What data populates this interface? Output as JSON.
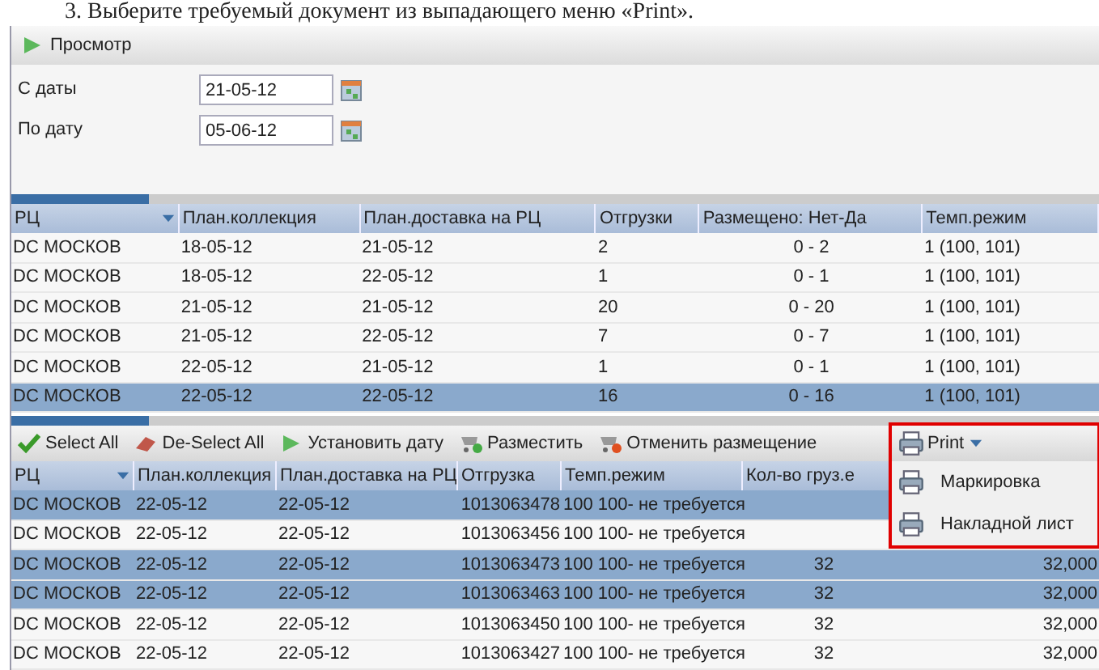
{
  "caption": "3.  Выберите требуемый документ из выпадающего меню «Print».",
  "toolbar": {
    "button": "Просмотр"
  },
  "date_fields": [
    {
      "label": "С даты",
      "value": "21-05-12"
    },
    {
      "label": "По дату",
      "value": "05-06-12"
    }
  ],
  "grid_top": {
    "columns": [
      "РЦ",
      "План.коллекция",
      "План.доставка на РЦ",
      "Отгрузки",
      "Размещено: Нет-Да",
      "Темп.режим"
    ],
    "rows": [
      {
        "cells": [
          "DC МОСКОВ",
          "18-05-12",
          "21-05-12",
          "2",
          "0 - 2",
          "1 (100, 101)"
        ],
        "selected": false
      },
      {
        "cells": [
          "DC МОСКОВ",
          "18-05-12",
          "22-05-12",
          "1",
          "0 - 1",
          "1 (100, 101)"
        ],
        "selected": false
      },
      {
        "cells": [
          "DC МОСКОВ",
          "21-05-12",
          "21-05-12",
          "20",
          "0 - 20",
          "1 (100, 101)"
        ],
        "selected": false
      },
      {
        "cells": [
          "DC МОСКОВ",
          "21-05-12",
          "22-05-12",
          "7",
          "0 - 7",
          "1 (100, 101)"
        ],
        "selected": false
      },
      {
        "cells": [
          "DC МОСКОВ",
          "22-05-12",
          "21-05-12",
          "1",
          "0 - 1",
          "1 (100, 101)"
        ],
        "selected": false
      },
      {
        "cells": [
          "DC МОСКОВ",
          "22-05-12",
          "22-05-12",
          "16",
          "0 - 16",
          "1 (100, 101)"
        ],
        "selected": true
      }
    ]
  },
  "grid_toolbar": {
    "buttons": [
      {
        "label": "Select All",
        "kind": "check"
      },
      {
        "label": "De-Select All",
        "kind": "eraser"
      },
      {
        "label": "Установить дату",
        "kind": "play"
      },
      {
        "label": "Разместить",
        "kind": "cart-add"
      },
      {
        "label": "Отменить размещение",
        "kind": "cart-remove"
      }
    ]
  },
  "print_menu": {
    "label": "Print",
    "items": [
      "Маркировка",
      "Накладной лист"
    ]
  },
  "grid_bottom": {
    "columns": [
      "РЦ",
      "План.коллекция",
      "План.доставка на РЦ",
      "Отгрузка",
      "Темп.режим",
      "Кол-во груз.е"
    ],
    "rows": [
      {
        "cells": [
          "DC МОСКОВ",
          "22-05-12",
          "22-05-12",
          "1013063478",
          "100 100- не требуется"
        ],
        "selected": true
      },
      {
        "cells": [
          "DC МОСКОВ",
          "22-05-12",
          "22-05-12",
          "1013063456",
          "100 100- не требуется"
        ],
        "selected": false
      },
      {
        "cells": [
          "DC МОСКОВ",
          "22-05-12",
          "22-05-12",
          "1013063473",
          "100 100- не требуется",
          "32",
          "32,000"
        ],
        "selected": true
      },
      {
        "cells": [
          "DC МОСКОВ",
          "22-05-12",
          "22-05-12",
          "1013063463",
          "100 100- не требуется",
          "32",
          "32,000"
        ],
        "selected": true
      },
      {
        "cells": [
          "DC МОСКОВ",
          "22-05-12",
          "22-05-12",
          "1013063450",
          "100 100- не требуется",
          "32",
          "32,000"
        ],
        "selected": false
      },
      {
        "cells": [
          "DC МОСКОВ",
          "22-05-12",
          "22-05-12",
          "1013063427",
          "100 100- не требуется",
          "32",
          "32,000"
        ],
        "selected": false
      }
    ]
  }
}
